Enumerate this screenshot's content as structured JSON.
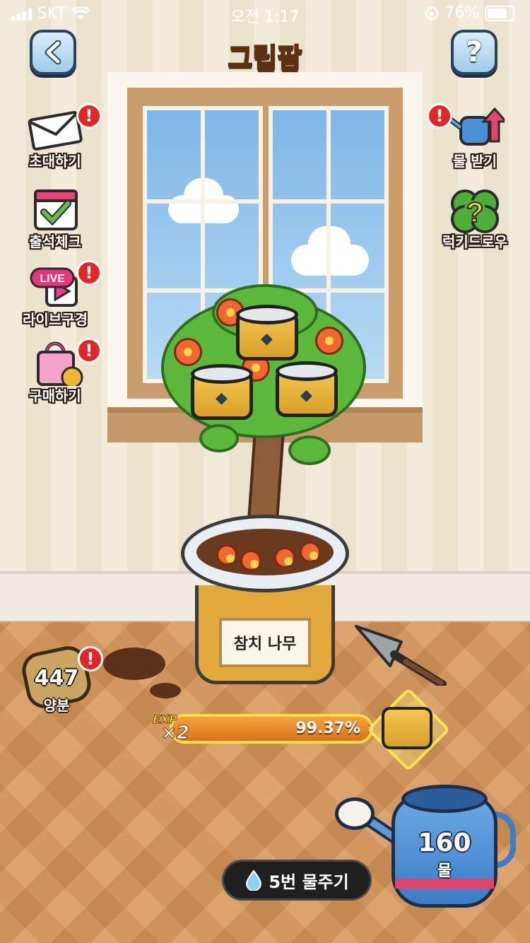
{
  "status_bar": {
    "carrier": "SKT",
    "time": "오전 1:17",
    "battery": "76%",
    "battery_level": 0.76
  },
  "header": {
    "back_icon": "chevron-left-icon",
    "logo_text": "그립팜",
    "help_icon": "question-mark-icon",
    "help_glyph": "?"
  },
  "left_menu": [
    {
      "label": "초대하기",
      "icon": "envelope-icon",
      "alert": true
    },
    {
      "label": "출석체크",
      "icon": "calendar-check-icon",
      "alert": false
    },
    {
      "label": "라이브구경",
      "icon": "live-play-icon",
      "badge": "LIVE",
      "alert": true
    },
    {
      "label": "구매하기",
      "icon": "shopping-bag-icon",
      "alert": true
    }
  ],
  "right_menu": [
    {
      "label": "물 받기",
      "icon": "watering-can-arrow-icon",
      "alert": true
    },
    {
      "label": "럭키드로우",
      "icon": "clover-question-icon",
      "alert": false
    }
  ],
  "alert_glyph": "!",
  "plant": {
    "pot_label": "참치 나무",
    "fruit_icon": "tuna-can-icon"
  },
  "fertilizer": {
    "count": "447",
    "label": "양분"
  },
  "exp": {
    "badge_top": "EXP",
    "badge_mult": "×2",
    "percent": "99.37%",
    "progress": 0.9937
  },
  "reward_icon": "tuna-can-icon",
  "water_button": {
    "label": "5번 물주기",
    "icon": "water-drop-icon"
  },
  "watering_can": {
    "count": "160",
    "label": "물"
  },
  "colors": {
    "alert": "#e42525",
    "exp_border": "#ffde44",
    "can_yellow": "#f2c64d",
    "leaf_green": "#5bb83a"
  }
}
